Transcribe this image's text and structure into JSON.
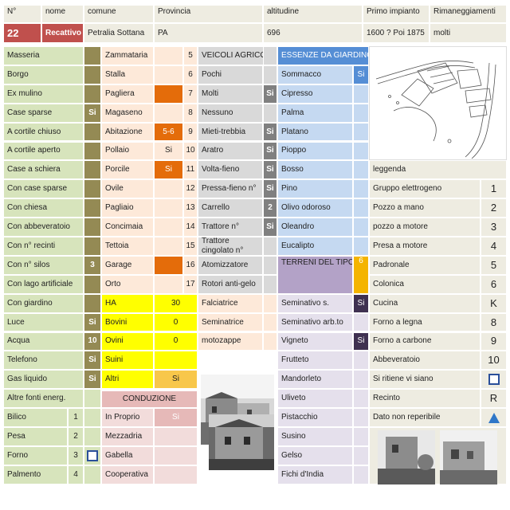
{
  "header": {
    "n_label": "N°",
    "nome_label": "nome",
    "comune_label": "comune",
    "provincia_label": "Provincia",
    "altitudine_label": "altitudine",
    "primo_impianto_label": "Primo impianto",
    "rimaneggiamenti_label": "Rimaneggiamenti"
  },
  "record": {
    "number": "22",
    "nome": "Recattivo",
    "comune": "Petralia Sottana",
    "provincia": "PA",
    "altitudine": "696",
    "primo_impianto": "1600 ? Poi 1875",
    "rimaneggiamenti": "molti"
  },
  "col1": [
    {
      "label": "Masseria",
      "value": ""
    },
    {
      "label": "Borgo",
      "value": ""
    },
    {
      "label": "Ex mulino",
      "value": ""
    },
    {
      "label": "Case sparse",
      "value": "Si"
    },
    {
      "label": "A cortile chiuso",
      "value": ""
    },
    {
      "label": "A cortile aperto",
      "value": ""
    },
    {
      "label": "Case a schiera",
      "value": ""
    },
    {
      "label": "Con case sparse",
      "value": ""
    },
    {
      "label": "Con chiesa",
      "value": ""
    },
    {
      "label": "Con abbeveratoio",
      "value": ""
    },
    {
      "label": "Con n° recinti",
      "value": ""
    },
    {
      "label": "Con n° silos",
      "value": "3"
    },
    {
      "label": "Con lago artificiale",
      "value": ""
    },
    {
      "label": "Con giardino",
      "value": ""
    },
    {
      "label": "Luce",
      "value": "Si"
    },
    {
      "label": "Acqua",
      "value": "10"
    },
    {
      "label": "Telefono",
      "value": "Si"
    },
    {
      "label": "Gas liquido",
      "value": "Si"
    },
    {
      "label": "Altre fonti energ.",
      "value": ""
    }
  ],
  "col1_bottom": [
    {
      "label": "Bilico",
      "num": "1"
    },
    {
      "label": "Pesa",
      "num": "2"
    },
    {
      "label": "Forno",
      "num": "3"
    },
    {
      "label": "Palmento",
      "num": "4"
    }
  ],
  "col2": [
    {
      "label": "Zammataria",
      "value": "",
      "num": "5"
    },
    {
      "label": "Stalla",
      "value": "",
      "num": "6"
    },
    {
      "label": "Pagliera",
      "value": "",
      "num": "7"
    },
    {
      "label": "Magaseno",
      "value": "",
      "num": "8"
    },
    {
      "label": "Abitazione",
      "value": "5-6",
      "num": "9"
    },
    {
      "label": "Pollaio",
      "value": "Si",
      "num": "10"
    },
    {
      "label": "Porcile",
      "value": "Si",
      "num": "11"
    },
    {
      "label": "Ovile",
      "value": "",
      "num": "12"
    },
    {
      "label": "Pagliaio",
      "value": "",
      "num": "13"
    },
    {
      "label": "Concimaia",
      "value": "",
      "num": "14"
    },
    {
      "label": "Tettoia",
      "value": "",
      "num": "15"
    },
    {
      "label": "Garage",
      "value": "",
      "num": "16"
    },
    {
      "label": "Orto",
      "value": "",
      "num": "17"
    }
  ],
  "animals": [
    {
      "label": "HA",
      "value": "30"
    },
    {
      "label": "Bovini",
      "value": "0"
    },
    {
      "label": "Ovini",
      "value": "0"
    },
    {
      "label": "Suini",
      "value": ""
    },
    {
      "label": "Altri",
      "value": "Si"
    }
  ],
  "conduzione": {
    "title": "CONDUZIONE",
    "rows": [
      {
        "label": "In Proprio",
        "value": "Si"
      },
      {
        "label": "Mezzadria",
        "value": ""
      },
      {
        "label": "Gabella",
        "value": ""
      },
      {
        "label": "Cooperativa",
        "value": ""
      }
    ]
  },
  "veicoli": {
    "title": "VEICOLI AGRICOLI",
    "rows": [
      {
        "label": "Pochi",
        "value": ""
      },
      {
        "label": "Molti",
        "value": "Si"
      },
      {
        "label": "Nessuno",
        "value": ""
      },
      {
        "label": "Mieti-trebbia",
        "value": "Si"
      },
      {
        "label": "Aratro",
        "value": "Si"
      },
      {
        "label": "Volta-fieno",
        "value": "Si"
      },
      {
        "label": "Pressa-fieno n°",
        "value": "Si"
      },
      {
        "label": "Carrello",
        "value": "2"
      },
      {
        "label": "Trattore n°",
        "value": "Si"
      },
      {
        "label": "Trattore cingolato n°",
        "value": ""
      },
      {
        "label": "Atomizzatore",
        "value": ""
      },
      {
        "label": "Rotori anti-gelo",
        "value": ""
      },
      {
        "label": "Falciatrice",
        "value": ""
      },
      {
        "label": "Seminatrice",
        "value": ""
      },
      {
        "label": "motozappe",
        "value": ""
      }
    ]
  },
  "essenze": {
    "title": "ESSENZE DA GIARDINO",
    "rows": [
      {
        "label": "Sommacco",
        "value": "Si"
      },
      {
        "label": "Cipresso",
        "value": ""
      },
      {
        "label": "Palma",
        "value": ""
      },
      {
        "label": "Platano",
        "value": ""
      },
      {
        "label": "Pioppo",
        "value": ""
      },
      {
        "label": "Bosso",
        "value": ""
      },
      {
        "label": "Pino",
        "value": ""
      },
      {
        "label": "Olivo odoroso",
        "value": ""
      },
      {
        "label": "Oleandro",
        "value": ""
      },
      {
        "label": "Eucalipto",
        "value": ""
      }
    ]
  },
  "terreni": {
    "title": "TERRENI DEL TIPO",
    "code": "6",
    "rows": [
      {
        "label": "Seminativo s.",
        "value": "Si"
      },
      {
        "label": "Seminativo arb.to",
        "value": ""
      },
      {
        "label": "Vigneto",
        "value": "Si"
      },
      {
        "label": "Frutteto",
        "value": ""
      },
      {
        "label": "Mandorleto",
        "value": ""
      },
      {
        "label": "Uliveto",
        "value": ""
      },
      {
        "label": "Pistacchio",
        "value": ""
      },
      {
        "label": "Susino",
        "value": ""
      },
      {
        "label": "Gelso",
        "value": ""
      },
      {
        "label": "Fichi d'India",
        "value": ""
      }
    ]
  },
  "legenda": {
    "title": "leggenda",
    "rows": [
      {
        "label": "Gruppo elettrogeno",
        "key": "1"
      },
      {
        "label": "Pozzo a mano",
        "key": "2"
      },
      {
        "label": "pozzo a motore",
        "key": "3"
      },
      {
        "label": "Presa a motore",
        "key": "4"
      },
      {
        "label": "Padronale",
        "key": "5"
      },
      {
        "label": "Colonica",
        "key": "6"
      },
      {
        "label": "Cucina",
        "key": "K"
      },
      {
        "label": "Forno a legna",
        "key": "8"
      },
      {
        "label": "Forno a carbone",
        "key": "9"
      },
      {
        "label": "Abbeveratoio",
        "key": "10"
      },
      {
        "label": "Si ritiene vi siano",
        "key": "square-icon"
      },
      {
        "label": "Recinto",
        "key": "R"
      },
      {
        "label": "Dato non reperibile",
        "key": "triangle-icon"
      }
    ]
  },
  "colors": {
    "green": "#d7e4bc",
    "olive": "#948a54",
    "peach": "#fde9d9",
    "orange": "#e46c0a",
    "gray": "#d9d9d9",
    "darkgray": "#808080",
    "blue": "#c5d9f1",
    "blue_strong": "#558ed5",
    "lavender": "#e5e0ec",
    "purple_dark": "#3f3151",
    "purple_mid": "#b3a2c7",
    "yellow": "#ffff00",
    "beige": "#eeece1",
    "header_red": "#c0504d",
    "pink": "#f2dcdb",
    "pink_strong": "#e6b9b8"
  }
}
